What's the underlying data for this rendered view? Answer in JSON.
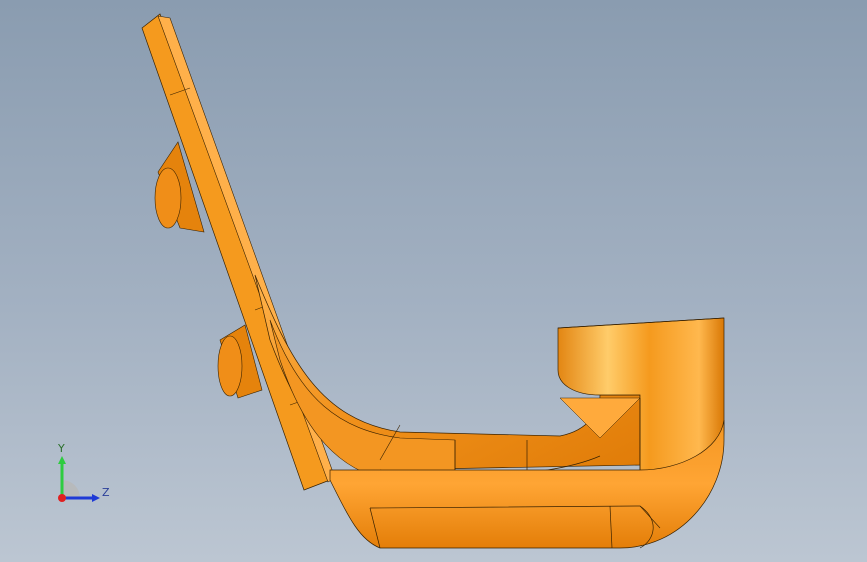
{
  "viewport": {
    "background_top": "#8a9cb0",
    "background_bottom": "#bcc6d2"
  },
  "model": {
    "part_color": "#f59a1e",
    "edge_color": "#3a2200"
  },
  "triad": {
    "y_label": "Y",
    "z_label": "Z",
    "y_color": "#2ecc40",
    "z_color": "#1f3ad6",
    "x_color": "#e02020"
  }
}
